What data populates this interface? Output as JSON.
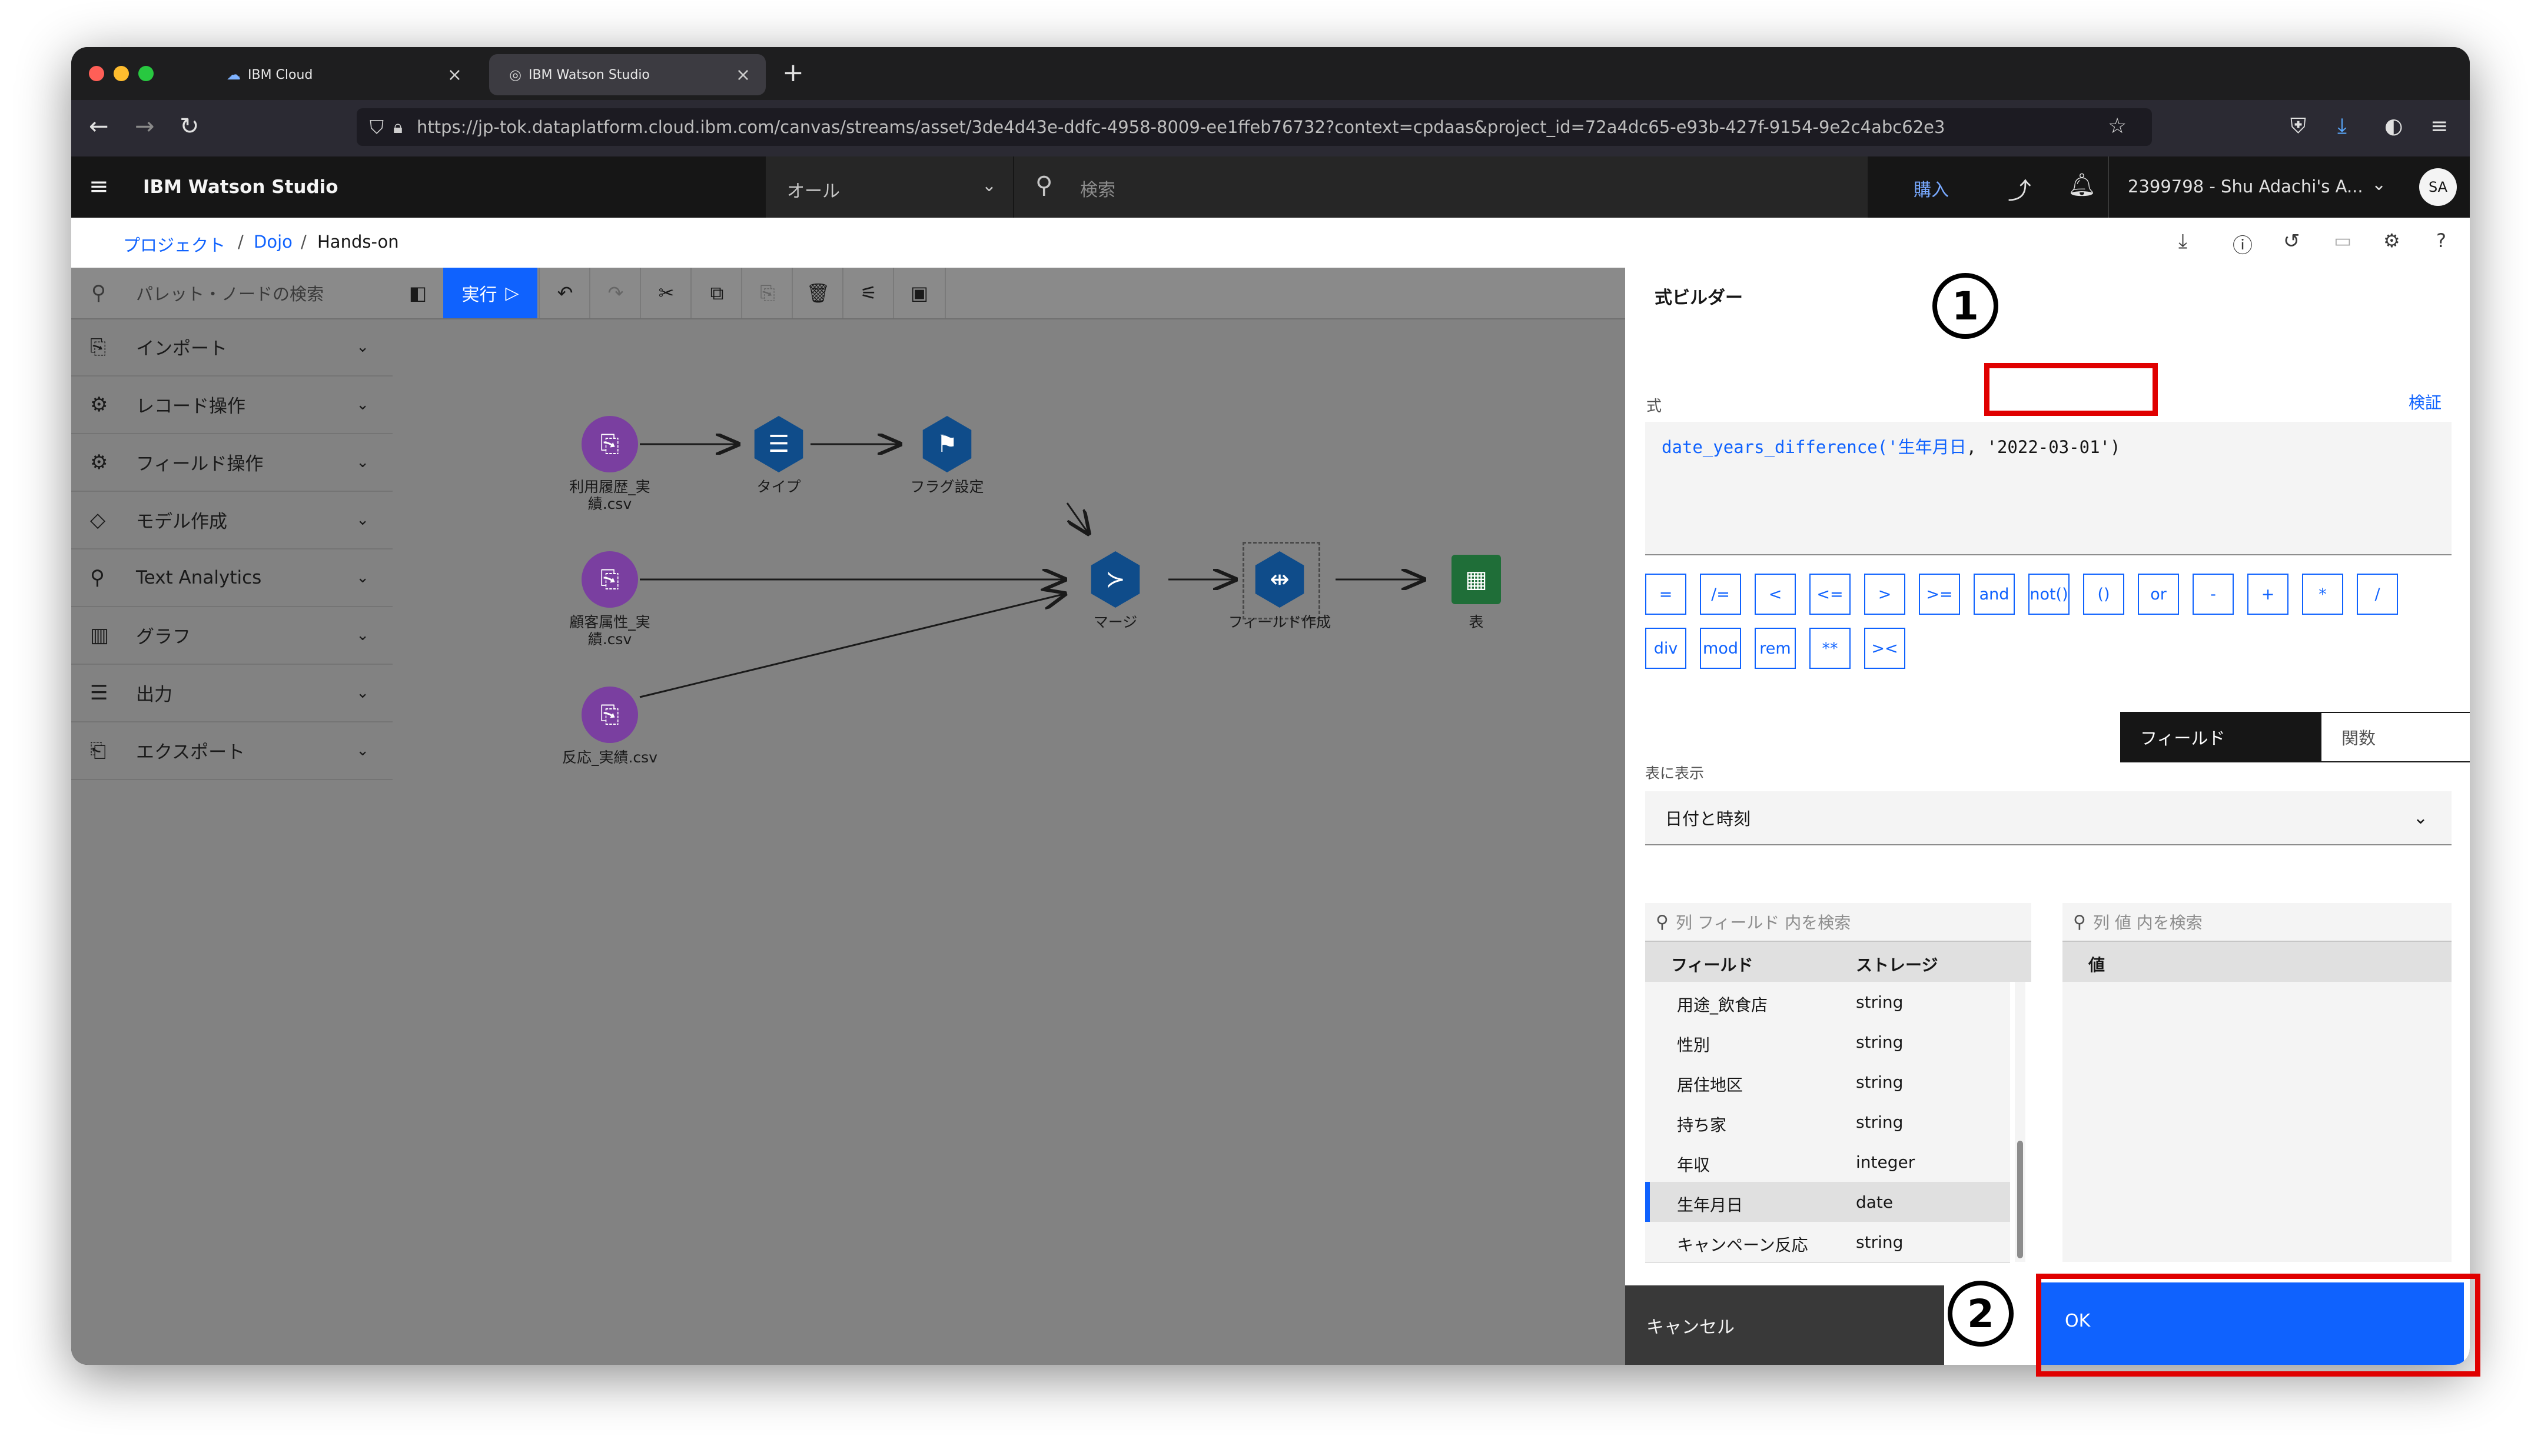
{
  "browser": {
    "tabs": [
      {
        "title": "IBM Cloud"
      },
      {
        "title": "IBM Watson Studio"
      }
    ],
    "new_tab": "+",
    "url": "https://jp-tok.dataplatform.cloud.ibm.com/canvas/streams/asset/3de4d43e-ddfc-4958-8009-ee1ffeb76732?context=cpdaas&project_id=72a4dc65-e93b-427f-9154-9e2c4abc62e3"
  },
  "app_header": {
    "menu_icon": "hamburger-icon",
    "title": "IBM Watson Studio",
    "scope": "オール",
    "search_placeholder": "検索",
    "buy": "購入",
    "account": "2399798 - Shu Adachi's A...",
    "avatar": "SA"
  },
  "breadcrumb": {
    "items": [
      "プロジェクト",
      "Dojo",
      "Hands-on"
    ],
    "sep": "/"
  },
  "palette": {
    "search_placeholder": "パレット・ノードの検索",
    "items": [
      {
        "label": "インポート",
        "icon": "import-icon"
      },
      {
        "label": "レコード操作",
        "icon": "record-ops-icon"
      },
      {
        "label": "フィールド操作",
        "icon": "field-ops-icon"
      },
      {
        "label": "モデル作成",
        "icon": "model-icon"
      },
      {
        "label": "Text Analytics",
        "icon": "text-analytics-icon"
      },
      {
        "label": "グラフ",
        "icon": "chart-icon"
      },
      {
        "label": "出力",
        "icon": "output-icon"
      },
      {
        "label": "エクスポート",
        "icon": "export-icon"
      }
    ]
  },
  "canvas": {
    "run_label": "実行",
    "nodes": [
      {
        "label": "利用履歴_実\n績.csv",
        "kind": "import"
      },
      {
        "label": "タイプ",
        "kind": "type"
      },
      {
        "label": "フラグ設定",
        "kind": "flag"
      },
      {
        "label": "顧客属性_実\n績.csv",
        "kind": "import"
      },
      {
        "label": "マージ",
        "kind": "merge"
      },
      {
        "label": "フィールド作成",
        "kind": "derive"
      },
      {
        "label": "表",
        "kind": "table"
      },
      {
        "label": "反応_実績.csv",
        "kind": "import"
      }
    ]
  },
  "expression_builder": {
    "title": "式ビルダー",
    "expr_label": "式",
    "validate": "検証",
    "expression_part1": "date_years_difference('生年月日",
    "expression_part2": ", '2022-03-01')",
    "operators": [
      "=",
      "/=",
      "<",
      "<=",
      ">",
      ">=",
      "and",
      "not()",
      "()",
      "or",
      "-",
      "+",
      "*",
      "/",
      "div",
      "mod",
      "rem",
      "**",
      "><"
    ],
    "tab_fields": "フィールド",
    "tab_functions": "関数",
    "show_label": "表に表示",
    "dropdown_value": "日付と時刻",
    "field_search_placeholder": "列 フィールド 内を検索",
    "value_search_placeholder": "列 値 内を検索",
    "col_field": "フィールド",
    "col_storage": "ストレージ",
    "col_value": "値",
    "rows": [
      {
        "field": "用途_飲食店",
        "storage": "string"
      },
      {
        "field": "性別",
        "storage": "string"
      },
      {
        "field": "居住地区",
        "storage": "string"
      },
      {
        "field": "持ち家",
        "storage": "string"
      },
      {
        "field": "年収",
        "storage": "integer"
      },
      {
        "field": "生年月日",
        "storage": "date"
      },
      {
        "field": "キャンペーン反応",
        "storage": "string"
      }
    ],
    "cancel": "キャンセル",
    "ok": "OK"
  },
  "annotations": {
    "badge1": "1",
    "badge2": "2",
    "highlight_color": "#e00000"
  },
  "colors": {
    "accent": "#0f62fe",
    "import_node": "#7a3fa0",
    "process_node": "#0f4c8a",
    "output_node": "#1f6e38"
  }
}
